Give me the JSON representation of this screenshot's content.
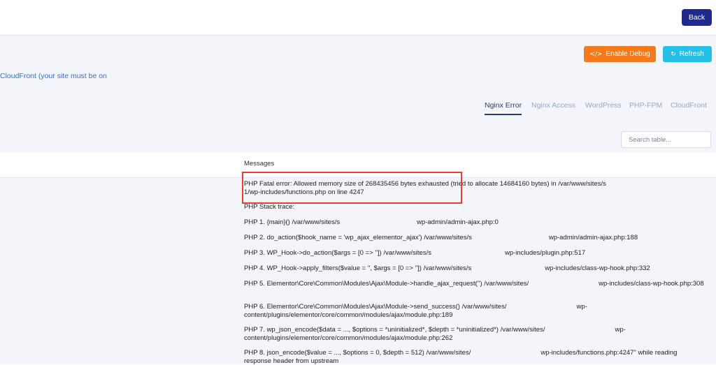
{
  "topbar": {
    "back_label": "Back"
  },
  "actions": {
    "debug_label": "Enable Debug",
    "debug_icon": "code-icon",
    "refresh_label": "Refresh",
    "refresh_icon": "refresh-icon"
  },
  "notice": {
    "text": "CloudFront (your site must be on"
  },
  "tabs": [
    {
      "label": "Nginx Error",
      "active": true
    },
    {
      "label": "Nginx Access",
      "active": false
    },
    {
      "label": "WordPress",
      "active": false
    },
    {
      "label": "PHP-FPM",
      "active": false
    },
    {
      "label": "CloudFront",
      "active": false
    }
  ],
  "search": {
    "placeholder": "Search table..."
  },
  "table": {
    "column_header": "Messages",
    "rows": [
      {
        "a": "PHP Fatal error: Allowed memory size of 268435456 bytes exhausted (tried to allocate 14684160 bytes) in /var/www/sites/s",
        "b": "1/wp-includes/functions.php on line 4247"
      },
      {
        "a": "PHP Stack trace:",
        "b": ""
      },
      {
        "a": "PHP 1. {main}() /var/www/sites/s",
        "b": "wp-admin/admin-ajax.php:0"
      },
      {
        "a": "PHP 2. do_action($hook_name = 'wp_ajax_elementor_ajax') /var/www/sites/s",
        "b": "wp-admin/admin-ajax.php:188"
      },
      {
        "a": "PHP 3. WP_Hook->do_action($args = [0 => '']) /var/www/sites/s",
        "b": "wp-includes/plugin.php:517"
      },
      {
        "a": "PHP 4. WP_Hook->apply_filters($value = '', $args = [0 => '']) /var/www/sites/s",
        "b": "wp-includes/class-wp-hook.php:332"
      },
      {
        "a": "PHP 5. Elementor\\Core\\Common\\Modules\\Ajax\\Module->handle_ajax_request('') /var/www/sites/",
        "b": "wp-includes/class-wp-hook.php:308"
      },
      {
        "a": "PHP 6. Elementor\\Core\\Common\\Modules\\Ajax\\Module->send_success() /var/www/sites/",
        "b": "wp-content/plugins/elementor/core/common/modules/ajax/module.php:189"
      },
      {
        "a": "PHP 7. wp_json_encode($data = ..., $options = *uninitialized*, $depth = *uninitialized*) /var/www/sites/",
        "b": "wp-content/plugins/elementor/core/common/modules/ajax/module.php:262"
      },
      {
        "a": "PHP 8. json_encode($value = ..., $options = 0, $depth = 512) /var/www/sites/",
        "b": "wp-includes/functions.php:4247\" while reading response header from upstream"
      }
    ]
  }
}
